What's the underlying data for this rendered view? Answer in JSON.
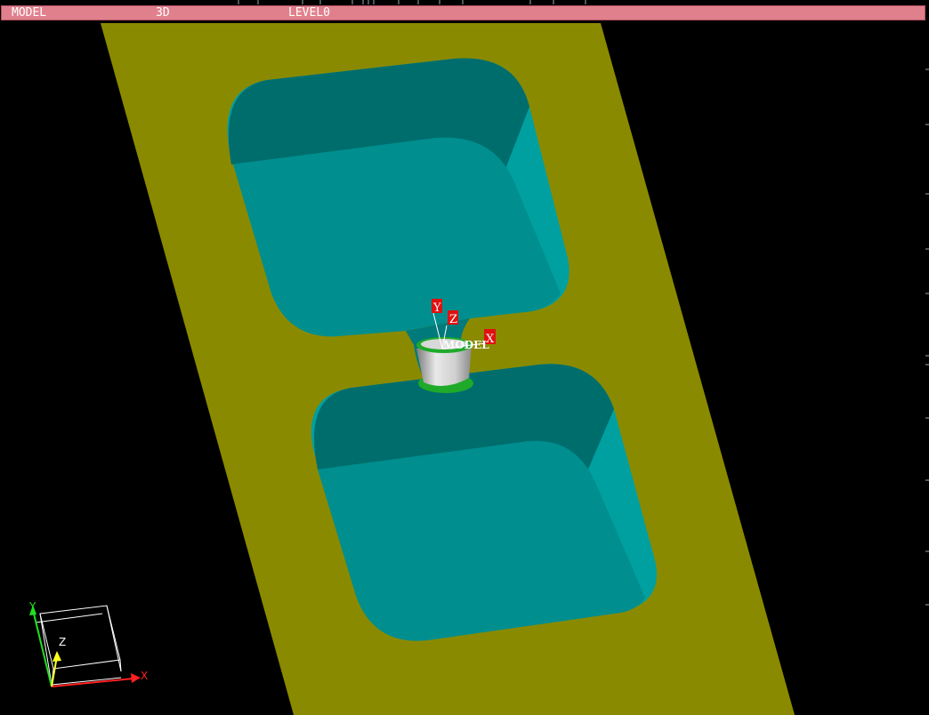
{
  "status_bar": {
    "mode": "MODEL",
    "view": "3D",
    "level": "LEVEL0"
  },
  "model_triad": {
    "x": "X",
    "y": "Y",
    "z": "Z",
    "label": "MODEL"
  },
  "view_cube": {
    "x": "X",
    "y": "Y",
    "z": "Z"
  },
  "colors": {
    "plate": "#8a8a00",
    "pocket_floor": "#00908f",
    "pocket_wall_dark": "#006d6d",
    "pocket_wall_light": "#00a6a6",
    "tool_body": "#d8d8d8",
    "tool_ring": "#1faa2a",
    "status_bar": "#e0808c",
    "axis_x": "#ff2020",
    "axis_y": "#20e020",
    "axis_z": "#ffff20"
  }
}
